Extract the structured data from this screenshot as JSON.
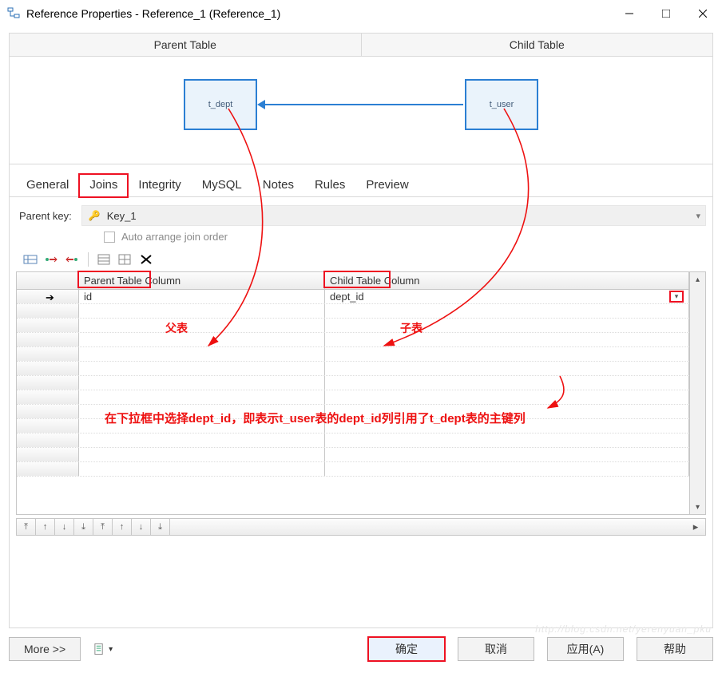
{
  "window": {
    "title": "Reference Properties - Reference_1 (Reference_1)"
  },
  "diagram": {
    "parent_header": "Parent Table",
    "child_header": "Child Table",
    "parent_name": "t_dept",
    "child_name": "t_user"
  },
  "tabs": {
    "general": "General",
    "joins": "Joins",
    "integrity": "Integrity",
    "mysql": "MySQL",
    "notes": "Notes",
    "rules": "Rules",
    "preview": "Preview",
    "active": "Joins"
  },
  "parent_key": {
    "label": "Parent key:",
    "value": "Key_1",
    "auto_arrange_label": "Auto arrange join order",
    "auto_arrange_checked": false
  },
  "grid": {
    "headers": {
      "parent": "Parent Table Column",
      "child": "Child Table Column"
    },
    "rows": [
      {
        "parent": "id",
        "child": "dept_id"
      }
    ]
  },
  "buttons": {
    "more": "More >>",
    "ok": "确定",
    "cancel": "取消",
    "apply": "应用(A)",
    "help": "帮助"
  },
  "annotations": {
    "parent_label": "父表",
    "child_label": "子表",
    "hint": "在下拉框中选择dept_id，即表示t_user表的dept_id列引用了t_dept表的主键列"
  },
  "watermark": "http://blog.csdn.net/yerenyuan_pku"
}
